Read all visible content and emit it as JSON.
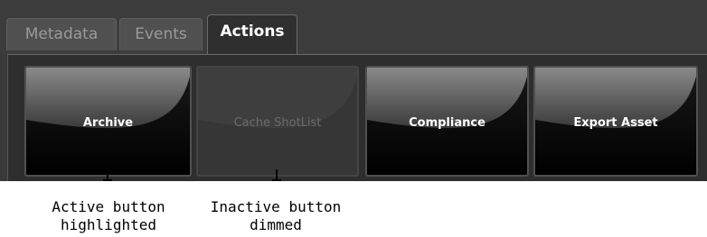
{
  "tabs": [
    {
      "label": "Metadata",
      "active": false
    },
    {
      "label": "Events",
      "active": false
    },
    {
      "label": "Actions",
      "active": true
    }
  ],
  "actions": [
    {
      "label": "Archive",
      "enabled": true
    },
    {
      "label": "Cache ShotList",
      "enabled": false
    },
    {
      "label": "Compliance",
      "enabled": true
    },
    {
      "label": "Export Asset",
      "enabled": true
    }
  ],
  "annotations": {
    "active": {
      "line1": "Active button",
      "line2": "highlighted"
    },
    "inactive": {
      "line1": "Inactive button",
      "line2": "dimmed"
    }
  },
  "colors": {
    "panel": "#3a3a3a",
    "button_active": "#000000",
    "button_disabled": "#363636",
    "text_active": "#ffffff",
    "text_disabled": "#6b6b6b"
  }
}
